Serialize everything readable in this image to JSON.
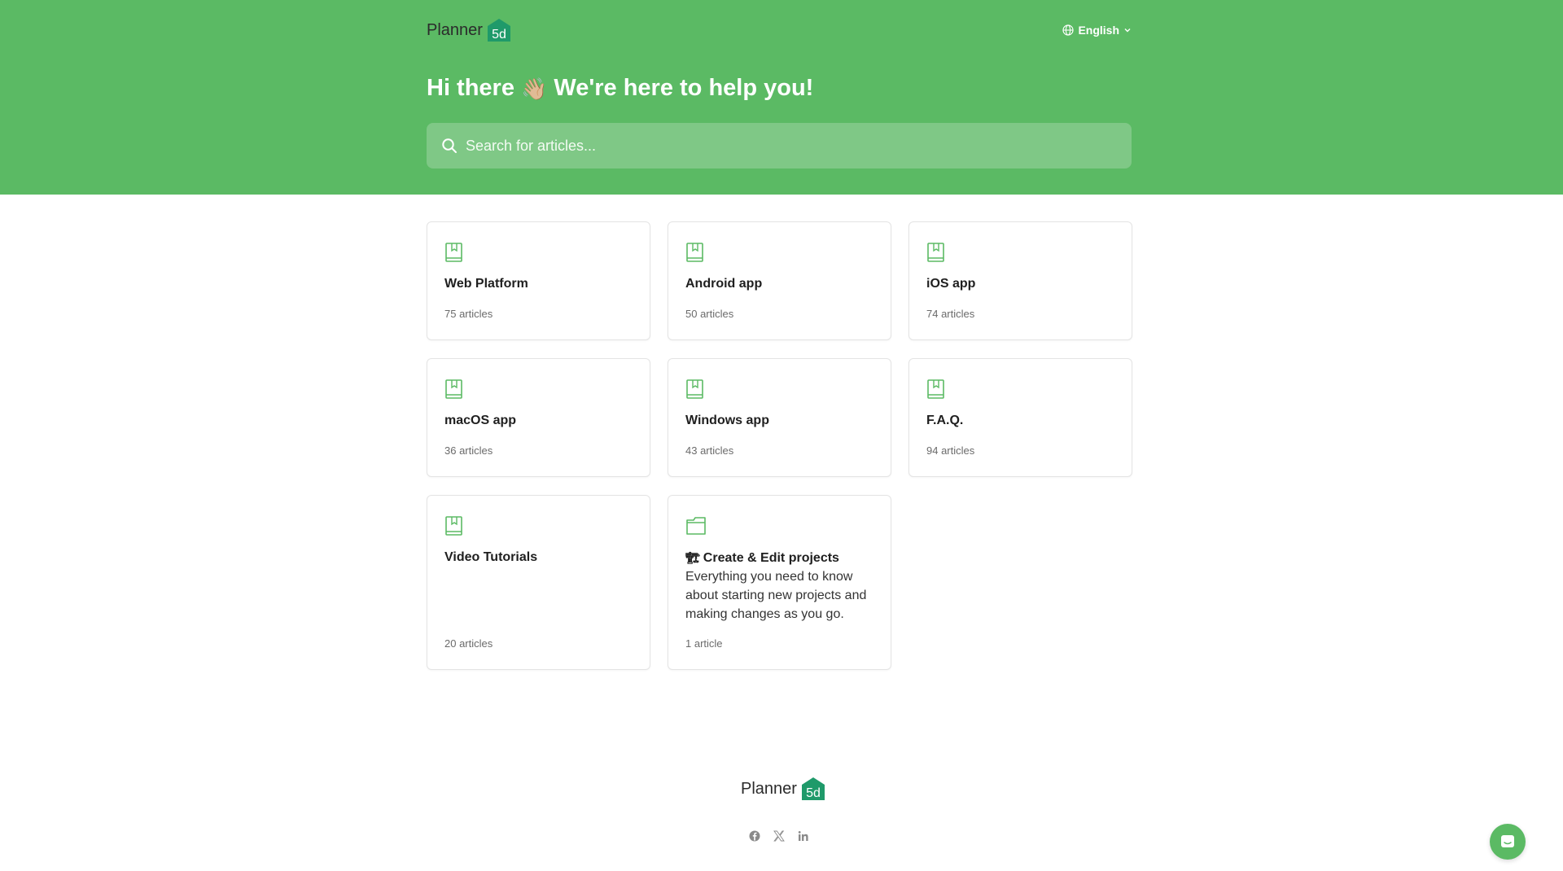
{
  "brand": {
    "name": "Planner",
    "mark": "5d",
    "color": "#5bba64"
  },
  "header": {
    "language": "English",
    "greeting": "Hi there",
    "greeting_emoji": "👋🏼",
    "tagline": "We're here to help you!",
    "search_placeholder": "Search for articles..."
  },
  "collections": [
    {
      "title": "Web Platform",
      "description": "",
      "count": "75 articles",
      "icon": "book-icon"
    },
    {
      "title": "Android app",
      "description": "",
      "count": "50 articles",
      "icon": "book-icon"
    },
    {
      "title": "iOS app",
      "description": "",
      "count": "74 articles",
      "icon": "book-icon"
    },
    {
      "title": "macOS app",
      "description": "",
      "count": "36 articles",
      "icon": "book-icon"
    },
    {
      "title": "Windows app",
      "description": "",
      "count": "43 articles",
      "icon": "book-icon"
    },
    {
      "title": "F.A.Q.",
      "description": "",
      "count": "94 articles",
      "icon": "book-icon"
    },
    {
      "title": "Video Tutorials",
      "description": "",
      "count": "20 articles",
      "icon": "book-icon"
    },
    {
      "title": "Create & Edit projects",
      "title_emoji": "🏗",
      "description": "Everything you need to know about starting new projects and making changes as you go.",
      "count": "1 article",
      "icon": "folder-icon"
    }
  ],
  "footer": {
    "socials": [
      "facebook-icon",
      "x-icon",
      "linkedin-icon"
    ]
  }
}
